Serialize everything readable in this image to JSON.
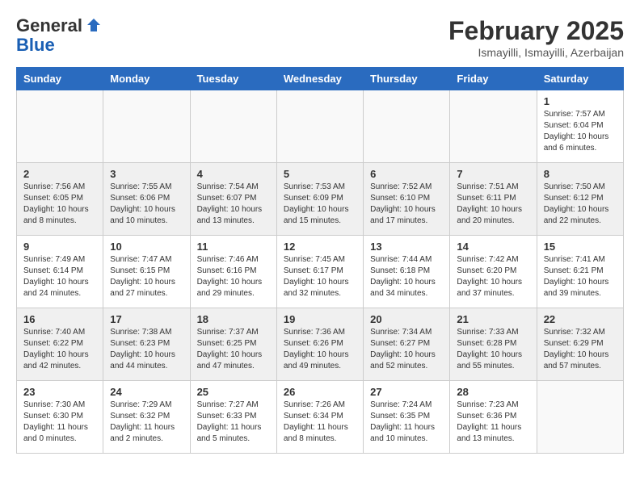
{
  "header": {
    "logo_general": "General",
    "logo_blue": "Blue",
    "title": "February 2025",
    "subtitle": "Ismayilli, Ismayilli, Azerbaijan"
  },
  "weekdays": [
    "Sunday",
    "Monday",
    "Tuesday",
    "Wednesday",
    "Thursday",
    "Friday",
    "Saturday"
  ],
  "weeks": [
    [
      {
        "day": "",
        "info": ""
      },
      {
        "day": "",
        "info": ""
      },
      {
        "day": "",
        "info": ""
      },
      {
        "day": "",
        "info": ""
      },
      {
        "day": "",
        "info": ""
      },
      {
        "day": "",
        "info": ""
      },
      {
        "day": "1",
        "info": "Sunrise: 7:57 AM\nSunset: 6:04 PM\nDaylight: 10 hours\nand 6 minutes."
      }
    ],
    [
      {
        "day": "2",
        "info": "Sunrise: 7:56 AM\nSunset: 6:05 PM\nDaylight: 10 hours\nand 8 minutes."
      },
      {
        "day": "3",
        "info": "Sunrise: 7:55 AM\nSunset: 6:06 PM\nDaylight: 10 hours\nand 10 minutes."
      },
      {
        "day": "4",
        "info": "Sunrise: 7:54 AM\nSunset: 6:07 PM\nDaylight: 10 hours\nand 13 minutes."
      },
      {
        "day": "5",
        "info": "Sunrise: 7:53 AM\nSunset: 6:09 PM\nDaylight: 10 hours\nand 15 minutes."
      },
      {
        "day": "6",
        "info": "Sunrise: 7:52 AM\nSunset: 6:10 PM\nDaylight: 10 hours\nand 17 minutes."
      },
      {
        "day": "7",
        "info": "Sunrise: 7:51 AM\nSunset: 6:11 PM\nDaylight: 10 hours\nand 20 minutes."
      },
      {
        "day": "8",
        "info": "Sunrise: 7:50 AM\nSunset: 6:12 PM\nDaylight: 10 hours\nand 22 minutes."
      }
    ],
    [
      {
        "day": "9",
        "info": "Sunrise: 7:49 AM\nSunset: 6:14 PM\nDaylight: 10 hours\nand 24 minutes."
      },
      {
        "day": "10",
        "info": "Sunrise: 7:47 AM\nSunset: 6:15 PM\nDaylight: 10 hours\nand 27 minutes."
      },
      {
        "day": "11",
        "info": "Sunrise: 7:46 AM\nSunset: 6:16 PM\nDaylight: 10 hours\nand 29 minutes."
      },
      {
        "day": "12",
        "info": "Sunrise: 7:45 AM\nSunset: 6:17 PM\nDaylight: 10 hours\nand 32 minutes."
      },
      {
        "day": "13",
        "info": "Sunrise: 7:44 AM\nSunset: 6:18 PM\nDaylight: 10 hours\nand 34 minutes."
      },
      {
        "day": "14",
        "info": "Sunrise: 7:42 AM\nSunset: 6:20 PM\nDaylight: 10 hours\nand 37 minutes."
      },
      {
        "day": "15",
        "info": "Sunrise: 7:41 AM\nSunset: 6:21 PM\nDaylight: 10 hours\nand 39 minutes."
      }
    ],
    [
      {
        "day": "16",
        "info": "Sunrise: 7:40 AM\nSunset: 6:22 PM\nDaylight: 10 hours\nand 42 minutes."
      },
      {
        "day": "17",
        "info": "Sunrise: 7:38 AM\nSunset: 6:23 PM\nDaylight: 10 hours\nand 44 minutes."
      },
      {
        "day": "18",
        "info": "Sunrise: 7:37 AM\nSunset: 6:25 PM\nDaylight: 10 hours\nand 47 minutes."
      },
      {
        "day": "19",
        "info": "Sunrise: 7:36 AM\nSunset: 6:26 PM\nDaylight: 10 hours\nand 49 minutes."
      },
      {
        "day": "20",
        "info": "Sunrise: 7:34 AM\nSunset: 6:27 PM\nDaylight: 10 hours\nand 52 minutes."
      },
      {
        "day": "21",
        "info": "Sunrise: 7:33 AM\nSunset: 6:28 PM\nDaylight: 10 hours\nand 55 minutes."
      },
      {
        "day": "22",
        "info": "Sunrise: 7:32 AM\nSunset: 6:29 PM\nDaylight: 10 hours\nand 57 minutes."
      }
    ],
    [
      {
        "day": "23",
        "info": "Sunrise: 7:30 AM\nSunset: 6:30 PM\nDaylight: 11 hours\nand 0 minutes."
      },
      {
        "day": "24",
        "info": "Sunrise: 7:29 AM\nSunset: 6:32 PM\nDaylight: 11 hours\nand 2 minutes."
      },
      {
        "day": "25",
        "info": "Sunrise: 7:27 AM\nSunset: 6:33 PM\nDaylight: 11 hours\nand 5 minutes."
      },
      {
        "day": "26",
        "info": "Sunrise: 7:26 AM\nSunset: 6:34 PM\nDaylight: 11 hours\nand 8 minutes."
      },
      {
        "day": "27",
        "info": "Sunrise: 7:24 AM\nSunset: 6:35 PM\nDaylight: 11 hours\nand 10 minutes."
      },
      {
        "day": "28",
        "info": "Sunrise: 7:23 AM\nSunset: 6:36 PM\nDaylight: 11 hours\nand 13 minutes."
      },
      {
        "day": "",
        "info": ""
      }
    ]
  ]
}
